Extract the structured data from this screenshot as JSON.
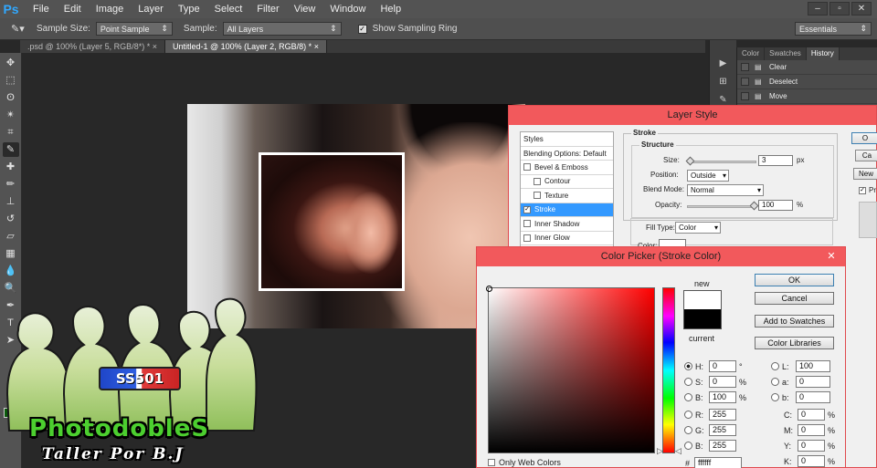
{
  "app": {
    "logo": "Ps",
    "menu": [
      "File",
      "Edit",
      "Image",
      "Layer",
      "Type",
      "Select",
      "Filter",
      "View",
      "Window",
      "Help"
    ],
    "window_controls": [
      "–",
      "▫",
      "✕"
    ]
  },
  "options_bar": {
    "sample_size_label": "Sample Size:",
    "sample_size_value": "Point Sample",
    "sample_label": "Sample:",
    "sample_value": "All Layers",
    "show_ring_label": "Show Sampling Ring",
    "workspace": "Essentials"
  },
  "tabs": [
    {
      "label": ".psd @ 100% (Layer 5, RGB/8*) *",
      "active": false
    },
    {
      "label": "Untitled-1 @ 100% (Layer 2, RGB/8) *",
      "active": true
    }
  ],
  "tools": [
    {
      "name": "move-tool-icon",
      "glyph": "✥"
    },
    {
      "name": "marquee-tool-icon",
      "glyph": "⬚"
    },
    {
      "name": "lasso-tool-icon",
      "glyph": "ʘ"
    },
    {
      "name": "magic-wand-tool-icon",
      "glyph": "✴"
    },
    {
      "name": "crop-tool-icon",
      "glyph": "⌗"
    },
    {
      "name": "eyedropper-tool-icon",
      "glyph": "✎",
      "selected": true
    },
    {
      "name": "healing-tool-icon",
      "glyph": "✚"
    },
    {
      "name": "brush-tool-icon",
      "glyph": "✏"
    },
    {
      "name": "stamp-tool-icon",
      "glyph": "⊥"
    },
    {
      "name": "history-brush-tool-icon",
      "glyph": "↺"
    },
    {
      "name": "eraser-tool-icon",
      "glyph": "▱"
    },
    {
      "name": "gradient-tool-icon",
      "glyph": "▦"
    },
    {
      "name": "blur-tool-icon",
      "glyph": "💧"
    },
    {
      "name": "dodge-tool-icon",
      "glyph": "🔍"
    },
    {
      "name": "pen-tool-icon",
      "glyph": "✒"
    },
    {
      "name": "type-tool-icon",
      "glyph": "T"
    },
    {
      "name": "path-select-tool-icon",
      "glyph": "➤"
    }
  ],
  "history_panel": {
    "tabs": [
      "Color",
      "Swatches",
      "History"
    ],
    "active_tab": "History",
    "items": [
      "Clear",
      "Deselect",
      "Move"
    ]
  },
  "layer_style": {
    "title": "Layer Style",
    "styles_header": "Styles",
    "blending_options": "Blending Options: Default",
    "items": [
      {
        "label": "Bevel & Emboss",
        "checked": false,
        "indent": false,
        "selected": false
      },
      {
        "label": "Contour",
        "checked": false,
        "indent": true,
        "selected": false
      },
      {
        "label": "Texture",
        "checked": false,
        "indent": true,
        "selected": false
      },
      {
        "label": "Stroke",
        "checked": true,
        "indent": false,
        "selected": true
      },
      {
        "label": "Inner Shadow",
        "checked": false,
        "indent": false,
        "selected": false
      },
      {
        "label": "Inner Glow",
        "checked": false,
        "indent": false,
        "selected": false
      }
    ],
    "stroke_title": "Stroke",
    "structure_title": "Structure",
    "size_label": "Size:",
    "size_value": "3",
    "size_unit": "px",
    "position_label": "Position:",
    "position_value": "Outside",
    "blend_mode_label": "Blend Mode:",
    "blend_mode_value": "Normal",
    "opacity_label": "Opacity:",
    "opacity_value": "100",
    "opacity_unit": "%",
    "fill_type_label": "Fill Type:",
    "fill_type_value": "Color",
    "color_label": "Color:",
    "buttons": [
      "O",
      "Ca",
      "New"
    ],
    "preview_label": "Pr"
  },
  "color_picker": {
    "title": "Color Picker (Stroke Color)",
    "new_label": "new",
    "current_label": "current",
    "new_color": "#ffffff",
    "current_color": "#000000",
    "buttons": {
      "ok": "OK",
      "cancel": "Cancel",
      "add_swatches": "Add to Swatches",
      "libraries": "Color Libraries"
    },
    "hsb": [
      {
        "label": "H:",
        "value": "0",
        "unit": "°",
        "checked": true
      },
      {
        "label": "S:",
        "value": "0",
        "unit": "%",
        "checked": false
      },
      {
        "label": "B:",
        "value": "100",
        "unit": "%",
        "checked": false
      }
    ],
    "rgb": [
      {
        "label": "R:",
        "value": "255"
      },
      {
        "label": "G:",
        "value": "255"
      },
      {
        "label": "B:",
        "value": "255"
      }
    ],
    "lab": [
      {
        "label": "L:",
        "value": "100"
      },
      {
        "label": "a:",
        "value": "0"
      },
      {
        "label": "b:",
        "value": "0"
      }
    ],
    "cmyk": [
      {
        "label": "C:",
        "value": "0",
        "unit": "%"
      },
      {
        "label": "M:",
        "value": "0",
        "unit": "%"
      },
      {
        "label": "Y:",
        "value": "0",
        "unit": "%"
      },
      {
        "label": "K:",
        "value": "0",
        "unit": "%"
      }
    ],
    "hex_label": "#",
    "hex_value": "ffffff",
    "web_only_label": "Only Web Colors"
  },
  "watermark": {
    "brand": "PhotodobleS",
    "subtitle": "Taller Por B.J",
    "badge": "SS501"
  },
  "colors": {
    "dialog_titlebar": "#f2595c",
    "selection": "#3399ff",
    "ps_blue": "#31a8ff",
    "brand_green": "#4ccf2f"
  }
}
